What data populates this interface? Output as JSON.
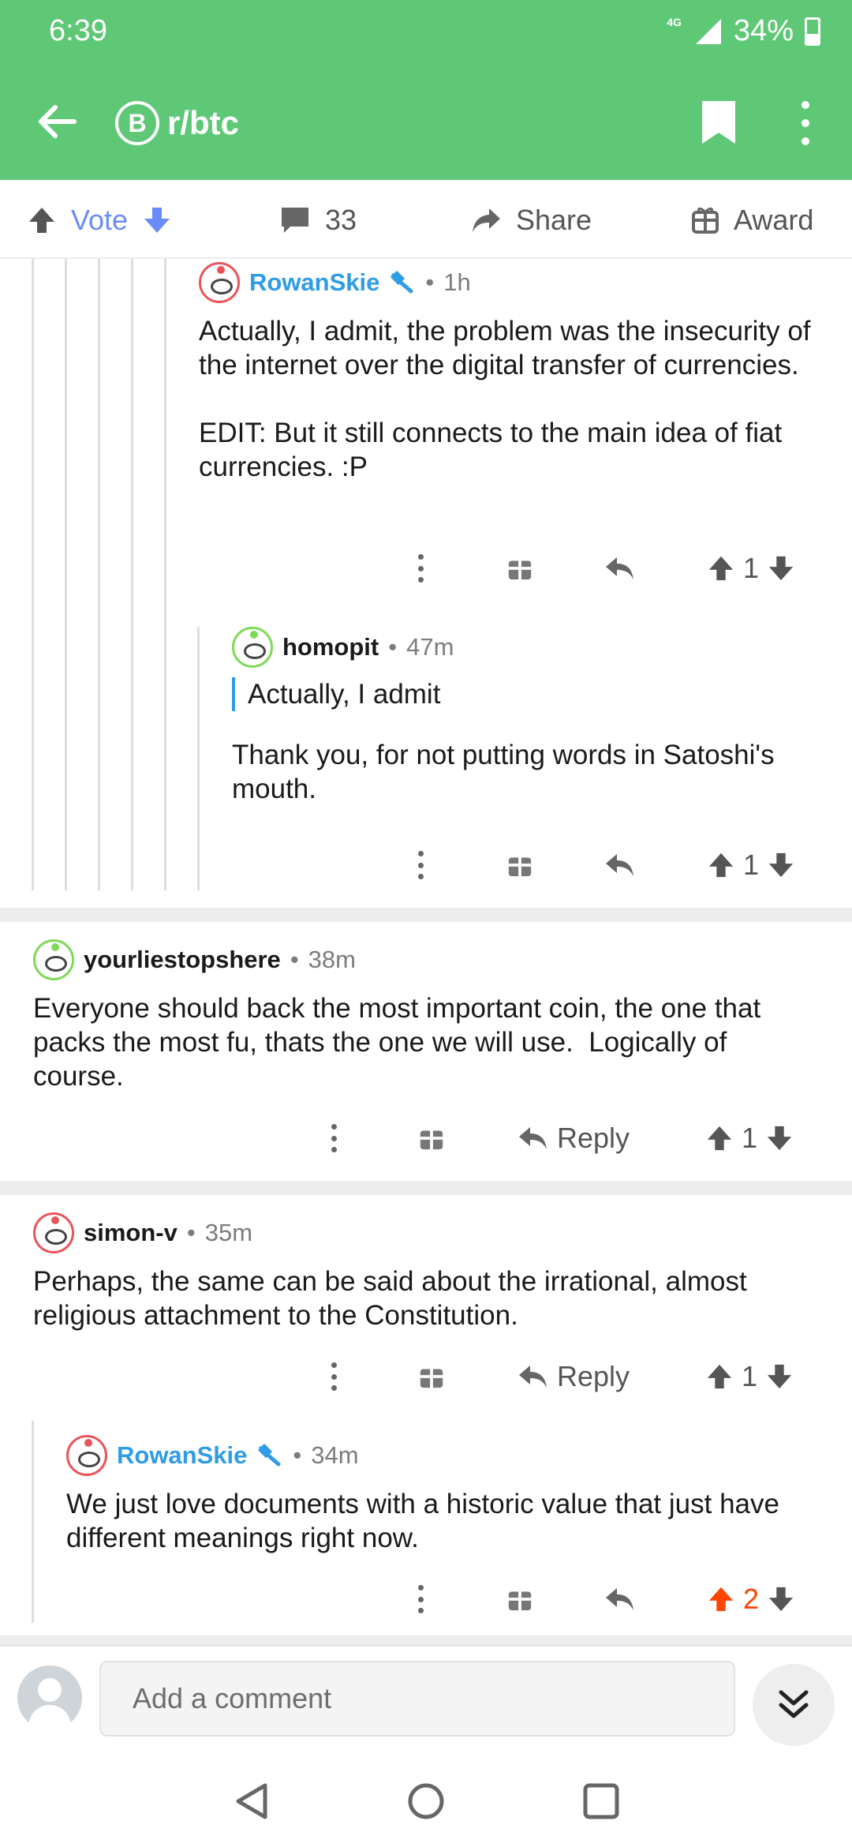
{
  "status": {
    "time": "6:39",
    "network": "4G",
    "battery": "34%"
  },
  "header": {
    "subreddit": "r/btc",
    "sub_icon_glyph": "B",
    "accent": "#5ec877"
  },
  "actions": {
    "vote_label": "Vote",
    "comments_count": "33",
    "share_label": "Share",
    "award_label": "Award"
  },
  "comments": [
    {
      "username": "RowanSkie",
      "time": "1h",
      "body": "Actually, I admit, the problem was the insecurity of the internet over the digital transfer of currencies.\n\nEDIT: But it still connects to the main idea of fiat currencies. :P",
      "score": "1"
    },
    {
      "username": "homopit",
      "time": "47m",
      "quote": "Actually, I admit",
      "body": "Thank you, for not putting words in Satoshi's mouth.",
      "score": "1"
    },
    {
      "username": "yourliestopshere",
      "time": "38m",
      "body": "Everyone should back the most important coin, the one that packs the most fu, thats the one we will use.  Logically of course.",
      "reply_label": "Reply",
      "score": "1"
    },
    {
      "username": "simon-v",
      "time": "35m",
      "body": "Perhaps, the same can be said about the irrational, almost religious attachment to the Constitution.",
      "reply_label": "Reply",
      "score": "1"
    },
    {
      "username": "RowanSkie",
      "time": "34m",
      "body": "We just love documents with a historic value that just have different meanings right now.",
      "score": "2",
      "upvoted": true
    }
  ],
  "composer": {
    "placeholder": "Add a comment"
  },
  "colors": {
    "op_blue": "#2e9ce6",
    "upvote_orange": "#ff4500",
    "vote_blue": "#6b8cf7"
  },
  "icons": [
    "back-arrow-icon",
    "bitcoin-icon",
    "bookmark-icon",
    "more-options-icon",
    "upvote-icon",
    "downvote-icon",
    "comment-icon",
    "share-icon",
    "award-icon",
    "reply-icon",
    "moderator-icon",
    "double-chevron-down-icon",
    "nav-back-icon",
    "nav-home-icon",
    "nav-recents-icon"
  ]
}
